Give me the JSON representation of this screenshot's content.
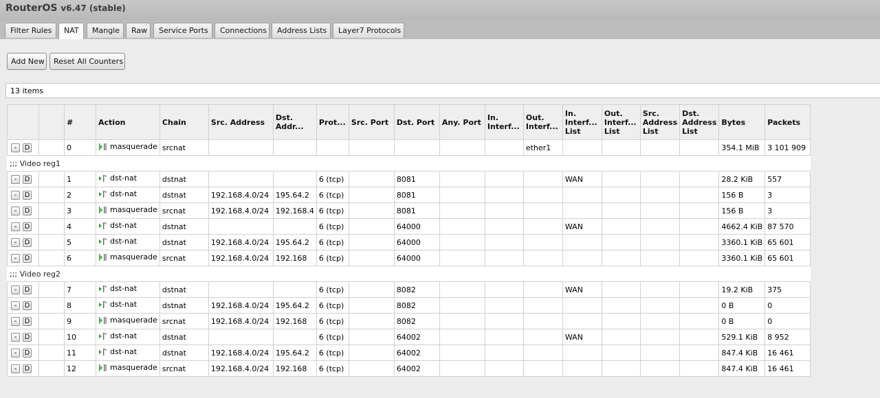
{
  "window": {
    "app": "RouterOS",
    "version": "v6.47 (stable)"
  },
  "tabs": [
    "Filter Rules",
    "NAT",
    "Mangle",
    "Raw",
    "Service Ports",
    "Connections",
    "Address Lists",
    "Layer7 Protocols"
  ],
  "active_tab": "NAT",
  "toolbar": {
    "add_label": "Add New",
    "reset_label": "Reset All Counters"
  },
  "status": {
    "items_count": "13 items"
  },
  "columns": [
    "",
    "",
    "#",
    "Action",
    "Chain",
    "Src. Address",
    "Dst. Addr...",
    "Prot...",
    "Src. Port",
    "Dst. Port",
    "Any. Port",
    "In. Interf...",
    "Out. Interf...",
    "In. Interf... List",
    "Out. Interf... List",
    "Src. Address List",
    "Dst. Address List",
    "Bytes",
    "Packets"
  ],
  "row_buttons": {
    "remove": "-",
    "disable": "D"
  },
  "rows": [
    {
      "type": "rule",
      "n": "0",
      "action": "masquerade",
      "icon": "masquerade",
      "chain": "srcnat",
      "src": "",
      "dst": "",
      "proto": "",
      "dport": "",
      "inif": "",
      "outif": "ether1",
      "iniflist": "",
      "bytes": "354.1 MiB",
      "packets": "3 101 909"
    },
    {
      "type": "comment",
      "text": ";;; Video reg1"
    },
    {
      "type": "rule",
      "n": "1",
      "action": "dst-nat",
      "icon": "dst-nat",
      "chain": "dstnat",
      "src": "",
      "dst": "",
      "proto": "6 (tcp)",
      "dport": "8081",
      "inif": "",
      "outif": "",
      "iniflist": "WAN",
      "bytes": "28.2 KiB",
      "packets": "557"
    },
    {
      "type": "rule",
      "n": "2",
      "action": "dst-nat",
      "icon": "dst-nat",
      "chain": "dstnat",
      "src": "192.168.4.0/24",
      "dst": "195.64.2",
      "proto": "6 (tcp)",
      "dport": "8081",
      "inif": "",
      "outif": "",
      "iniflist": "",
      "bytes": "156 B",
      "packets": "3"
    },
    {
      "type": "rule",
      "n": "3",
      "action": "masquerade",
      "icon": "masquerade",
      "chain": "srcnat",
      "src": "192.168.4.0/24",
      "dst": "192.168.4",
      "proto": "6 (tcp)",
      "dport": "8081",
      "inif": "",
      "outif": "",
      "iniflist": "",
      "bytes": "156 B",
      "packets": "3"
    },
    {
      "type": "rule",
      "n": "4",
      "action": "dst-nat",
      "icon": "dst-nat",
      "chain": "dstnat",
      "src": "",
      "dst": "",
      "proto": "6 (tcp)",
      "dport": "64000",
      "inif": "",
      "outif": "",
      "iniflist": "WAN",
      "bytes": "4662.4 KiB",
      "packets": "87 570"
    },
    {
      "type": "rule",
      "n": "5",
      "action": "dst-nat",
      "icon": "dst-nat",
      "chain": "dstnat",
      "src": "192.168.4.0/24",
      "dst": "195.64.2",
      "proto": "6 (tcp)",
      "dport": "64000",
      "inif": "",
      "outif": "",
      "iniflist": "",
      "bytes": "3360.1 KiB",
      "packets": "65 601"
    },
    {
      "type": "rule",
      "n": "6",
      "action": "masquerade",
      "icon": "masquerade",
      "chain": "srcnat",
      "src": "192.168.4.0/24",
      "dst": "192.168",
      "proto": "6 (tcp)",
      "dport": "64000",
      "inif": "",
      "outif": "",
      "iniflist": "",
      "bytes": "3360.1 KiB",
      "packets": "65 601"
    },
    {
      "type": "comment",
      "text": ";;; Video reg2"
    },
    {
      "type": "rule",
      "n": "7",
      "action": "dst-nat",
      "icon": "dst-nat",
      "chain": "dstnat",
      "src": "",
      "dst": "",
      "proto": "6 (tcp)",
      "dport": "8082",
      "inif": "",
      "outif": "",
      "iniflist": "WAN",
      "bytes": "19.2 KiB",
      "packets": "375"
    },
    {
      "type": "rule",
      "n": "8",
      "action": "dst-nat",
      "icon": "dst-nat",
      "chain": "dstnat",
      "src": "192.168.4.0/24",
      "dst": "195.64.2",
      "proto": "6 (tcp)",
      "dport": "8082",
      "inif": "",
      "outif": "",
      "iniflist": "",
      "bytes": "0 B",
      "packets": "0"
    },
    {
      "type": "rule",
      "n": "9",
      "action": "masquerade",
      "icon": "masquerade",
      "chain": "srcnat",
      "src": "192.168.4.0/24",
      "dst": "192.168",
      "proto": "6 (tcp)",
      "dport": "8082",
      "inif": "",
      "outif": "",
      "iniflist": "",
      "bytes": "0 B",
      "packets": "0"
    },
    {
      "type": "rule",
      "n": "10",
      "action": "dst-nat",
      "icon": "dst-nat",
      "chain": "dstnat",
      "src": "",
      "dst": "",
      "proto": "6 (tcp)",
      "dport": "64002",
      "inif": "",
      "outif": "",
      "iniflist": "WAN",
      "bytes": "529.1 KiB",
      "packets": "8 952"
    },
    {
      "type": "rule",
      "n": "11",
      "action": "dst-nat",
      "icon": "dst-nat",
      "chain": "dstnat",
      "src": "192.168.4.0/24",
      "dst": "195.64.2",
      "proto": "6 (tcp)",
      "dport": "64002",
      "inif": "",
      "outif": "",
      "iniflist": "",
      "bytes": "847.4 KiB",
      "packets": "16 461"
    },
    {
      "type": "rule",
      "n": "12",
      "action": "masquerade",
      "icon": "masquerade",
      "chain": "srcnat",
      "src": "192.168.4.0/24",
      "dst": "192.168",
      "proto": "6 (tcp)",
      "dport": "64002",
      "inif": "",
      "outif": "",
      "iniflist": "",
      "bytes": "847.4 KiB",
      "packets": "16 461"
    }
  ],
  "colors": {
    "icon_green": "#2e9a2e",
    "icon_gray": "#666666"
  }
}
